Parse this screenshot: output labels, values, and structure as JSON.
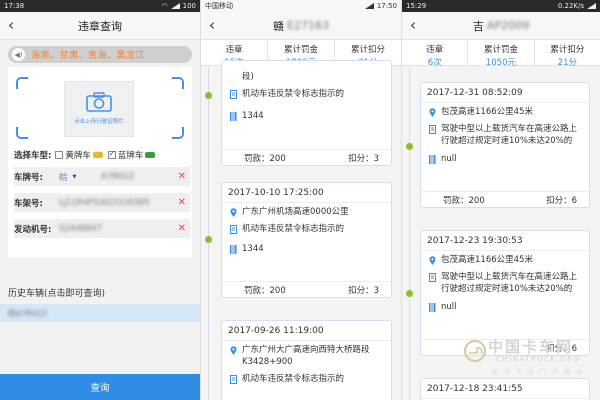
{
  "screen1": {
    "status": {
      "time": "17:38",
      "battery": "100"
    },
    "title": "违章查询",
    "notice": "海南、甘肃、青海、黑龙江",
    "upload_label": "点击上传行驶证照片",
    "car_type_label": "选择车型:",
    "car_types": [
      {
        "label": "黄牌车",
        "checked": false,
        "color": "#f0b429"
      },
      {
        "label": "蓝牌车",
        "checked": true,
        "color": "#3a9c3a"
      }
    ],
    "plate": {
      "label": "车牌号:",
      "province": "皖",
      "value": "A7R022"
    },
    "frame": {
      "label": "车架号:",
      "value": "LJ11R4FG4G3316365"
    },
    "engine": {
      "label": "发动机号:",
      "value": "S2446847"
    },
    "history_title": "历史车辆(点击即可查询)",
    "history_item": "皖A7R022",
    "query_button": "查询"
  },
  "screen2": {
    "status": {
      "carrier": "中国移动",
      "time": "17:50"
    },
    "title": "赣",
    "title_blur": "E27163",
    "summary": [
      {
        "key": "违章",
        "value": "15次"
      },
      {
        "key": "累计罚金",
        "value": "1820元"
      },
      {
        "key": "累计扣分",
        "value": "21分"
      }
    ],
    "records": [
      {
        "time": "",
        "location": "段)",
        "reason": "机动车违反禁令标志指示的",
        "code": "1344",
        "fine": "罚款：200",
        "points": "扣分：3"
      },
      {
        "time": "2017-10-10 17:25:00",
        "location": "广东广州机场高速0000公里",
        "reason": "机动车违反禁令标志指示的",
        "code": "1344",
        "fine": "罚款：200",
        "points": "扣分：3"
      },
      {
        "time": "2017-09-26 11:19:00",
        "location": "广东广州大广高速向西特大桥路段K3428+900",
        "reason": "机动车违反禁令标志指示的",
        "code": "",
        "fine": "",
        "points": ""
      }
    ]
  },
  "screen3": {
    "status": {
      "time": "15:29",
      "net": "0.22K/s"
    },
    "title": "吉",
    "title_blur": "AP2009",
    "summary": [
      {
        "key": "违章",
        "value": "6次"
      },
      {
        "key": "累计罚金",
        "value": "1050元"
      },
      {
        "key": "累计扣分",
        "value": "21分"
      }
    ],
    "records": [
      {
        "time": "2017-12-31 08:52:09",
        "location": "包茂高速1166公里45米",
        "reason": "驾驶中型以上载货汽车在高速公路上行驶超过规定时速10%未达20%的",
        "code": "null",
        "fine": "罚款：200",
        "points": "扣分：6"
      },
      {
        "time": "2017-12-23 19:30:53",
        "location": "包茂高速1166公里45米",
        "reason": "驾驶中型以上载货汽车在高速公路上行驶超过规定时速10%未达20%的",
        "code": "null",
        "fine": "",
        "points": "扣分：6"
      },
      {
        "time": "2017-12-18 23:41:55",
        "location": "",
        "reason": "",
        "code": "",
        "fine": "",
        "points": ""
      }
    ],
    "watermark": {
      "cn": "中国卡车网",
      "en": "CHINATRUCK.ORG",
      "sub": "四大卡车门户网站"
    }
  },
  "colors": {
    "accent": "#2f8de4",
    "notice": "#ff7a2e",
    "dot": "#8bbf2c",
    "clear": "#e04a4a"
  },
  "icons": [
    "back-chevron-icon",
    "camera-icon",
    "speaker-icon",
    "location-pin-icon",
    "document-icon",
    "barcode-icon",
    "truck-icon",
    "close-icon"
  ]
}
